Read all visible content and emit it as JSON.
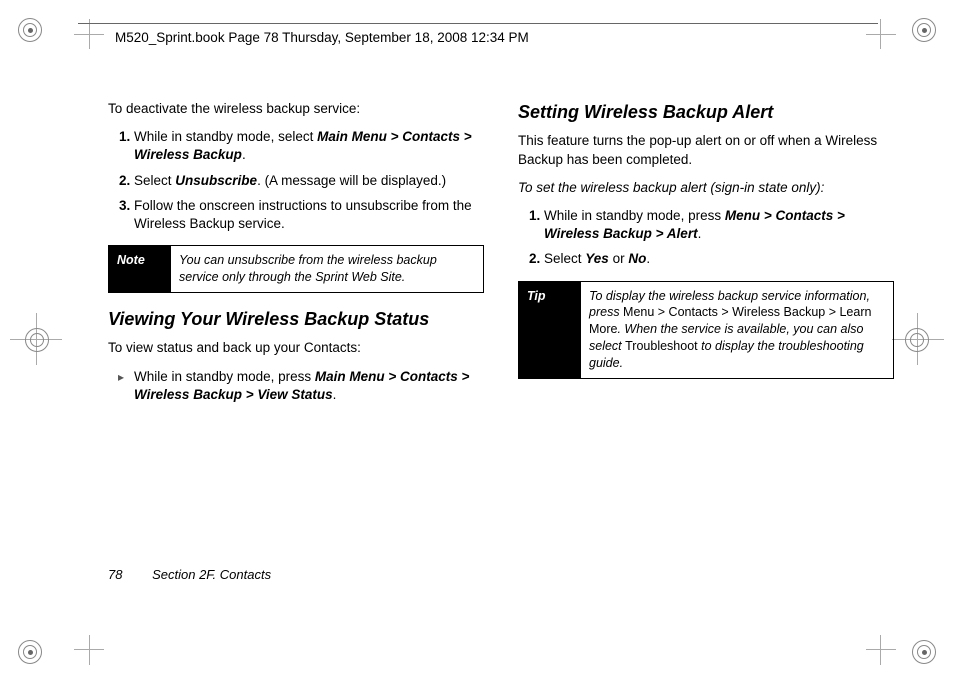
{
  "header": {
    "running": "M520_Sprint.book  Page 78  Thursday, September 18, 2008  12:34 PM"
  },
  "left": {
    "intro": "To deactivate the wireless backup service:",
    "steps": {
      "s1_a": "While in standby mode, select ",
      "s1_b": "Main Menu > Contacts > Wireless Backup",
      "s1_c": ".",
      "s2_a": "Select ",
      "s2_b": "Unsubscribe",
      "s2_c": ". (A message will be displayed.)",
      "s3": "Follow the onscreen instructions to unsubscribe from the Wireless Backup service."
    },
    "note": {
      "tag": "Note",
      "body": "You can unsubscribe from the wireless backup service only through the Sprint Web Site."
    },
    "sect2_title": "Viewing Your Wireless Backup Status",
    "sect2_intro": "To view status and back up your Contacts:",
    "sect2_item": {
      "a": "While in standby mode, press ",
      "b": "Main Menu > Contacts > Wireless Backup > View Status",
      "c": "."
    }
  },
  "right": {
    "title": "Setting Wireless Backup Alert",
    "intro": "This feature turns the pop-up alert on or off when a Wireless Backup has been completed.",
    "sub": "To set the wireless backup alert (sign-in state only):",
    "steps": {
      "s1_a": "While in standby mode, press ",
      "s1_b": "Menu > Contacts > Wireless Backup > Alert",
      "s1_c": ".",
      "s2_a": "Select ",
      "s2_y": "Yes",
      "s2_or": " or ",
      "s2_n": "No",
      "s2_c": "."
    },
    "tip": {
      "tag": "Tip",
      "a": "To display the wireless backup service information, press ",
      "b": "Menu > Contacts > Wireless Backup > Learn More",
      "c": ". When the service is available, you can also select ",
      "d": "Troubleshoot",
      "e": " to display the troubleshooting guide."
    }
  },
  "footer": {
    "page": "78",
    "section": "Section 2F. Contacts"
  },
  "marks": {
    "arrow": "▸"
  }
}
